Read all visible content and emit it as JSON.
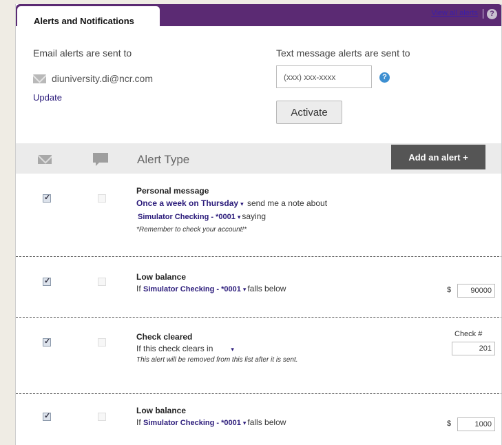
{
  "header": {
    "tab_title": "Alerts and Notifications",
    "view_all": "View all alerts",
    "help_glyph": "?"
  },
  "email": {
    "label": "Email alerts are sent to",
    "address": "diuniversity.di@ncr.com",
    "update": "Update",
    "icon": "envelope-icon"
  },
  "text_msg": {
    "label": "Text message alerts are sent to",
    "placeholder": "(xxx) xxx-xxxx",
    "help_glyph": "?",
    "activate": "Activate"
  },
  "table": {
    "alert_type_header": "Alert Type",
    "add_alert": "Add an alert +",
    "email_icon": "envelope-icon",
    "sms_icon": "chat-bubble-icon"
  },
  "alerts": [
    {
      "title": "Personal message",
      "frequency": "Once a week on Thursday",
      "after_freq": "send me a note about",
      "account": "Simulator Checking - *0001",
      "after_account": "saying",
      "note": "*Remember to check your account!*",
      "email_checked": true,
      "sms_checked": false
    },
    {
      "title": "Low balance",
      "prefix": "If",
      "account": "Simulator Checking - *0001",
      "suffix": "falls below",
      "currency": "$",
      "amount": "90000",
      "email_checked": true,
      "sms_checked": false
    },
    {
      "title": "Check cleared",
      "line": "If this check clears in",
      "note": "This alert will be removed from this list after it is sent.",
      "check_label": "Check #",
      "check_number": "201",
      "email_checked": true,
      "sms_checked": false
    },
    {
      "title": "Low balance",
      "prefix": "If",
      "account": "Simulator Checking - *0001",
      "suffix": "falls below",
      "currency": "$",
      "amount": "1000",
      "email_checked": true,
      "sms_checked": false
    }
  ],
  "caret_glyph": "▾"
}
